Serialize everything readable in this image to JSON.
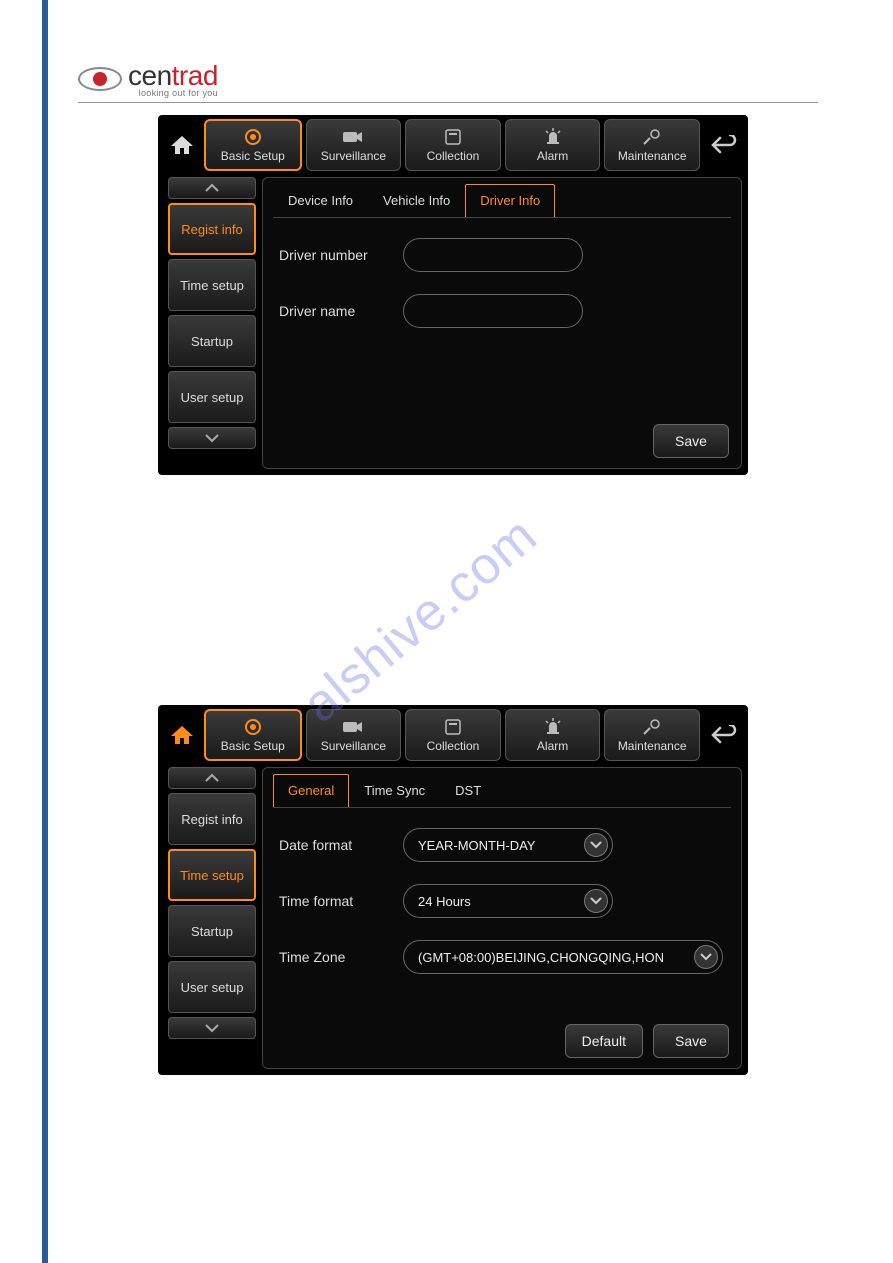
{
  "logo": {
    "brand_prefix": "cen",
    "brand_suffix": "trad",
    "tagline": "looking out for you"
  },
  "watermark": "alshive.com",
  "screen1": {
    "topnav": [
      {
        "label": "Basic Setup",
        "icon": "gear"
      },
      {
        "label": "Surveillance",
        "icon": "camera"
      },
      {
        "label": "Collection",
        "icon": "disk"
      },
      {
        "label": "Alarm",
        "icon": "siren"
      },
      {
        "label": "Maintenance",
        "icon": "wrench-gear"
      }
    ],
    "topnav_active": 0,
    "sidebar": [
      "Regist info",
      "Time setup",
      "Startup",
      "User setup"
    ],
    "sidebar_active": 0,
    "tabs": [
      "Device Info",
      "Vehicle Info",
      "Driver Info"
    ],
    "tab_active": 2,
    "fields": [
      {
        "label": "Driver number",
        "value": ""
      },
      {
        "label": "Driver name",
        "value": ""
      }
    ],
    "buttons": {
      "save": "Save"
    }
  },
  "screen2": {
    "topnav": [
      {
        "label": "Basic Setup",
        "icon": "gear"
      },
      {
        "label": "Surveillance",
        "icon": "camera"
      },
      {
        "label": "Collection",
        "icon": "disk"
      },
      {
        "label": "Alarm",
        "icon": "siren"
      },
      {
        "label": "Maintenance",
        "icon": "wrench-gear"
      }
    ],
    "topnav_active": 0,
    "sidebar": [
      "Regist info",
      "Time setup",
      "Startup",
      "User setup"
    ],
    "sidebar_active": 1,
    "tabs": [
      "General",
      "Time Sync",
      "DST"
    ],
    "tab_active": 0,
    "fields": [
      {
        "label": "Date format",
        "value": "YEAR-MONTH-DAY",
        "type": "select"
      },
      {
        "label": "Time format",
        "value": "24 Hours",
        "type": "select"
      },
      {
        "label": "Time Zone",
        "value": "(GMT+08:00)BEIJING,CHONGQING,HON",
        "type": "select",
        "wide": true
      }
    ],
    "buttons": {
      "default": "Default",
      "save": "Save"
    }
  }
}
